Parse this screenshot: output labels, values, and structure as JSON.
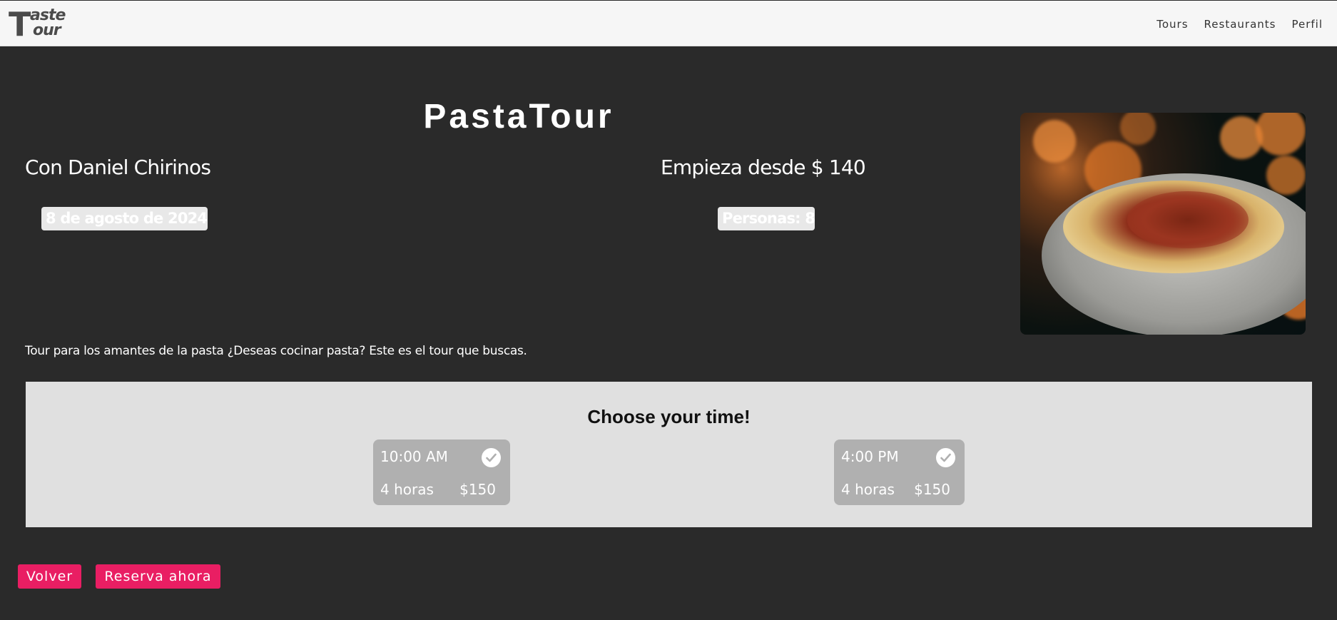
{
  "brand": {
    "logo_letter": "T",
    "logo_word_1": "aste",
    "logo_word_2": "our"
  },
  "nav": {
    "items": [
      "Tours",
      "Restaurants",
      "Perfil"
    ]
  },
  "tour": {
    "title": "PastaTour",
    "guide": "Con Daniel Chirinos",
    "price": "Empieza desde $ 140",
    "date": "8 de agosto de 2024",
    "persons": "Personas: 8",
    "description": "Tour para los amantes de la pasta ¿Deseas cocinar pasta? Este es el tour que buscas."
  },
  "chooser": {
    "title": "Choose your time!",
    "slots": [
      {
        "time": "10:00 AM",
        "duration": "4 horas",
        "price": "$150",
        "selected": true
      },
      {
        "time": "4:00 PM",
        "duration": "4 horas",
        "price": "$150",
        "selected": true
      }
    ]
  },
  "buttons": {
    "back": "Volver",
    "book": "Reserva ahora"
  },
  "colors": {
    "background": "#2a2a2a",
    "navbar": "#f6f6f6",
    "accent": "#e91e63",
    "panel": "#e0e0e0",
    "slot": "#b0b0b0"
  }
}
